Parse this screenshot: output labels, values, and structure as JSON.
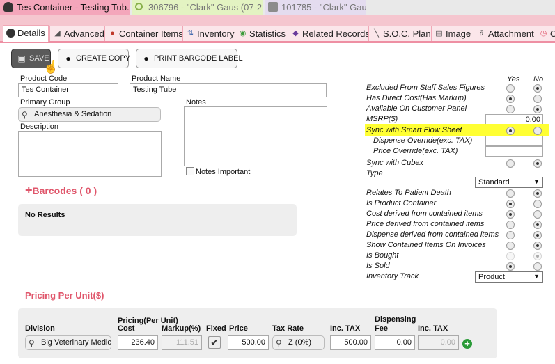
{
  "window_tabs": [
    {
      "label": "Tes Container - Testing Tub..."
    },
    {
      "label": "306796 - \"Clark\" Gaus (07-2..."
    },
    {
      "label": "101785 - \"Clark\" Gaus"
    }
  ],
  "sub_tabs": [
    {
      "label": "Details"
    },
    {
      "label": "Advanced"
    },
    {
      "label": "Container Items"
    },
    {
      "label": "Inventory"
    },
    {
      "label": "Statistics"
    },
    {
      "label": "Related Records"
    },
    {
      "label": "S.O.C. Plan"
    },
    {
      "label": "Image"
    },
    {
      "label": "Attachment"
    },
    {
      "label": "O"
    }
  ],
  "toolbar": {
    "save_label": "SAVE",
    "copy_label": "CREATE COPY",
    "print_label": "PRINT BARCODE LABEL"
  },
  "form": {
    "product_code_label": "Product Code",
    "product_code": "Tes Container",
    "product_name_label": "Product Name",
    "product_name": "Testing Tube",
    "primary_group_label": "Primary Group",
    "primary_group": "Anesthesia & Sedation",
    "notes_label": "Notes",
    "description_label": "Description",
    "notes_important_label": "Notes Important"
  },
  "barcodes": {
    "title": "Barcodes ( 0 )",
    "empty": "No Results"
  },
  "flags": {
    "yes_label": "Yes",
    "no_label": "No",
    "excluded": "Excluded From Staff Sales Figures",
    "direct_cost": "Has Direct Cost(Has Markup)",
    "customer_panel": "Available On Customer Panel",
    "msrp": "MSRP($)",
    "msrp_value": "0.00",
    "sync_smart": "Sync with Smart Flow Sheet",
    "dispense_override": "Dispense Override(exc. TAX)",
    "price_override": "Price Override(exc. TAX)",
    "sync_cubex": "Sync with Cubex",
    "type_label": "Type",
    "type_value": "Standard",
    "patient_death": "Relates To Patient Death",
    "is_container": "Is Product Container",
    "cost_derived": "Cost derived from contained items",
    "price_derived": "Price derived from contained items",
    "dispense_derived": "Dispense derived from contained items",
    "show_items": "Show Contained Items On Invoices",
    "is_bought": "Is Bought",
    "is_sold": "Is Sold",
    "inventory_track": "Inventory Track",
    "inventory_value": "Product"
  },
  "pricing": {
    "title": "Pricing Per Unit($)",
    "h_division": "Division",
    "h_pricing": "Pricing(Per Unit)",
    "h_cost": "Cost",
    "h_markup": "Markup(%)",
    "h_fixed": "Fixed",
    "h_price": "Price",
    "h_taxrate": "Tax Rate",
    "h_inctax": "Inc. TAX",
    "h_dispensing": "Dispensing",
    "h_fee": "Fee",
    "h_inctax2": "Inc. TAX",
    "division": "Big Veterinary Medic",
    "cost": "236.40",
    "markup": "111.51",
    "fixed_mark": "✔",
    "price": "500.00",
    "taxrate": "Z (0%)",
    "inctax": "500.00",
    "fee": "0.00",
    "inctax2": "0.00",
    "add": "+"
  }
}
